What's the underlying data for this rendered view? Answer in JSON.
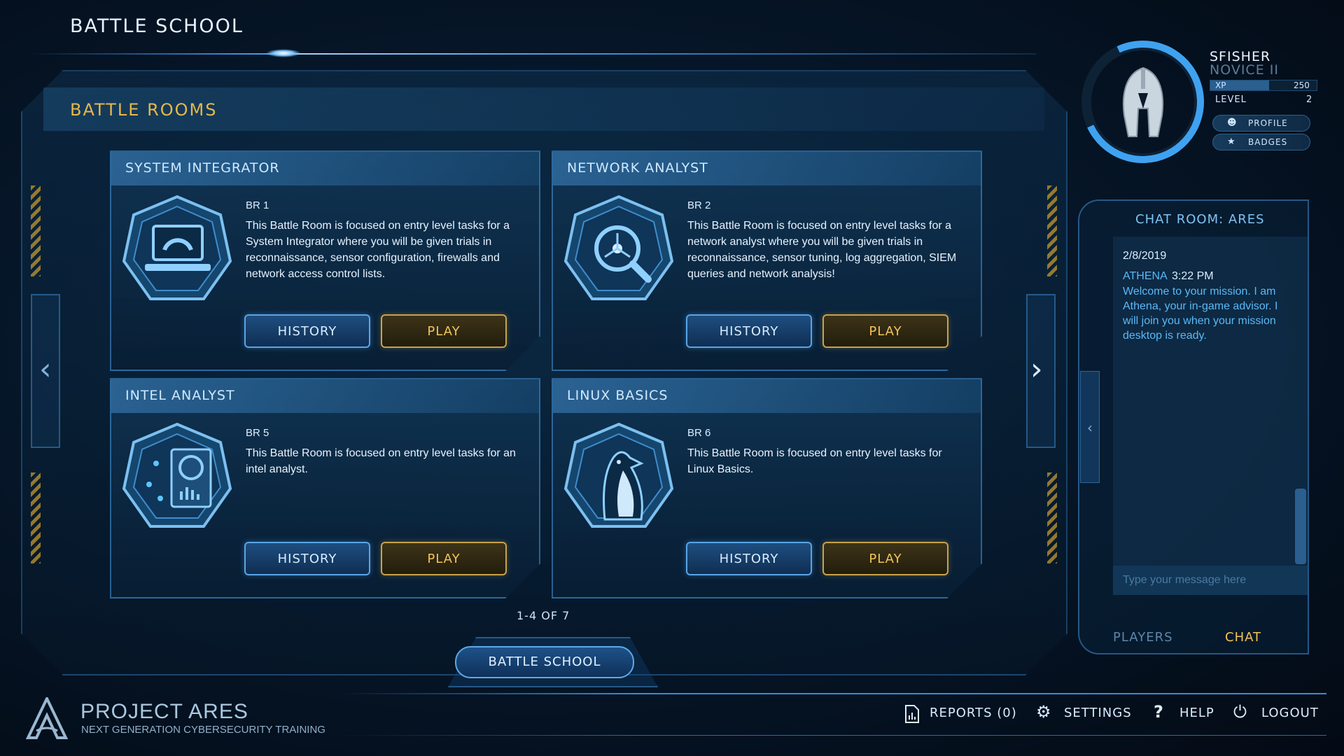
{
  "header": {
    "title": "BATTLE SCHOOL"
  },
  "section": {
    "title": "BATTLE ROOMS"
  },
  "rooms": [
    {
      "title": "SYSTEM INTEGRATOR",
      "code": "BR 1",
      "description": "This Battle Room is focused on entry level tasks for a System Integrator where you will be given trials in reconnaissance, sensor configuration, firewalls and network access control lists.",
      "icon": "laptop-gear-icon",
      "history_label": "HISTORY",
      "play_label": "PLAY"
    },
    {
      "title": "NETWORK ANALYST",
      "code": "BR 2",
      "description": "This Battle Room is focused on entry level tasks for a network analyst where you will be given trials in reconnaissance, sensor tuning, log aggregation, SIEM queries and network analysis!",
      "icon": "network-magnifier-icon",
      "history_label": "HISTORY",
      "play_label": "PLAY"
    },
    {
      "title": "INTEL ANALYST",
      "code": "BR 5",
      "description": "This Battle Room is focused on entry level tasks for an intel analyst.",
      "icon": "intel-device-icon",
      "history_label": "HISTORY",
      "play_label": "PLAY"
    },
    {
      "title": "LINUX BASICS",
      "code": "BR 6",
      "description": "This Battle Room is focused on entry level tasks for Linux Basics.",
      "icon": "penguin-icon",
      "history_label": "HISTORY",
      "play_label": "PLAY"
    }
  ],
  "pager": {
    "text": "1-4 OF 7"
  },
  "bottom_tab": {
    "label": "BATTLE SCHOOL"
  },
  "profile": {
    "username": "SFISHER",
    "rank": "NOVICE II",
    "xp_label": "XP",
    "xp_value": "250",
    "xp_fraction": 0.55,
    "level_label": "LEVEL",
    "level_value": "2",
    "profile_label": "PROFILE",
    "badges_label": "BADGES",
    "avatar_icon": "spartan-helmet-icon"
  },
  "chat": {
    "title": "CHAT ROOM: ARES",
    "date": "2/8/2019",
    "messages": [
      {
        "user": "ATHENA",
        "time": "3:22 PM",
        "text": "Welcome to your mission. I am Athena, your in-game advisor. I will join you when your mission desktop is ready."
      }
    ],
    "input_placeholder": "Type your message here",
    "tabs": {
      "players": "PLAYERS",
      "chat": "CHAT"
    }
  },
  "footer": {
    "brand": "PROJECT ARES",
    "tagline": "NEXT GENERATION CYBERSECURITY TRAINING",
    "reports_label": "REPORTS (0)",
    "settings_label": "SETTINGS",
    "help_label": "HELP",
    "logout_label": "LOGOUT"
  },
  "colors": {
    "accent_blue": "#3fa2f0",
    "accent_gold": "#e6b84a",
    "background": "#06172a"
  }
}
